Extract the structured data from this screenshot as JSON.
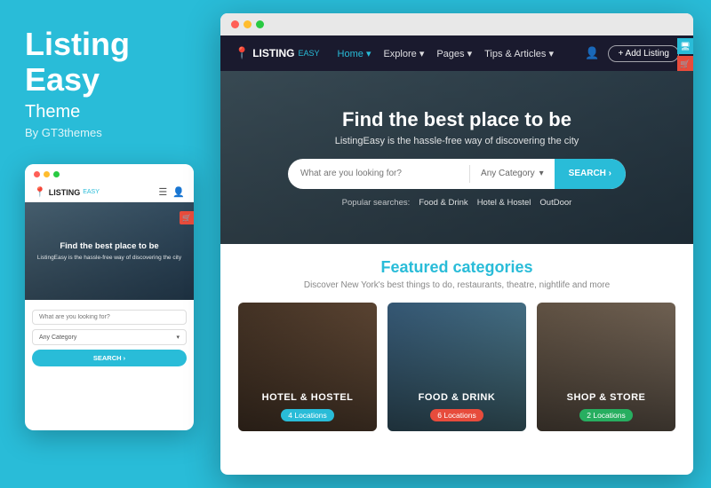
{
  "left": {
    "brand_line1": "Listing",
    "brand_line2": "Easy",
    "brand_subtitle": "Theme",
    "brand_by": "By GT3themes"
  },
  "mobile": {
    "logo_text": "LISTING",
    "logo_easy": "EASY",
    "hero_title": "Find the best place to be",
    "hero_sub": "ListingEasy is the hassle-free way of discovering the city",
    "search_placeholder": "What are you looking for?",
    "category_label": "Any Category",
    "search_btn": "SEARCH ›",
    "dots": [
      "●",
      "●",
      "●"
    ]
  },
  "browser": {
    "dots": [
      "●",
      "●",
      "●"
    ]
  },
  "navbar": {
    "logo_text": "LISTING",
    "logo_easy": "EASY",
    "links": [
      {
        "label": "Home ›",
        "active": true
      },
      {
        "label": "Explore ›"
      },
      {
        "label": "Pages ›"
      },
      {
        "label": "Tips & Articles ›"
      }
    ],
    "add_btn": "+ Add Listing",
    "side_icons": [
      "🖥",
      "🛒",
      "📋",
      "💬"
    ]
  },
  "hero": {
    "title": "Find the best place to be",
    "subtitle": "ListingEasy is the hassle-free way of discovering the city",
    "search_placeholder": "What are you looking for?",
    "category_label": "Any Category",
    "search_btn": "SEARCH ›",
    "popular_label": "Popular searches:",
    "popular_tags": [
      "Food & Drink",
      "Hotel & Hostel",
      "OutDoor"
    ]
  },
  "featured": {
    "title": "Featured categories",
    "subtitle": "Discover New York's best things to do, restaurants, theatre, nightlife and more",
    "cards": [
      {
        "title": "HOTEL & HOSTEL",
        "badge": "4 Locations",
        "badge_color": "teal"
      },
      {
        "title": "FOOD & DRINK",
        "badge": "6 Locations",
        "badge_color": "red"
      },
      {
        "title": "SHOP & STORE",
        "badge": "2 Locations",
        "badge_color": "green"
      }
    ]
  }
}
